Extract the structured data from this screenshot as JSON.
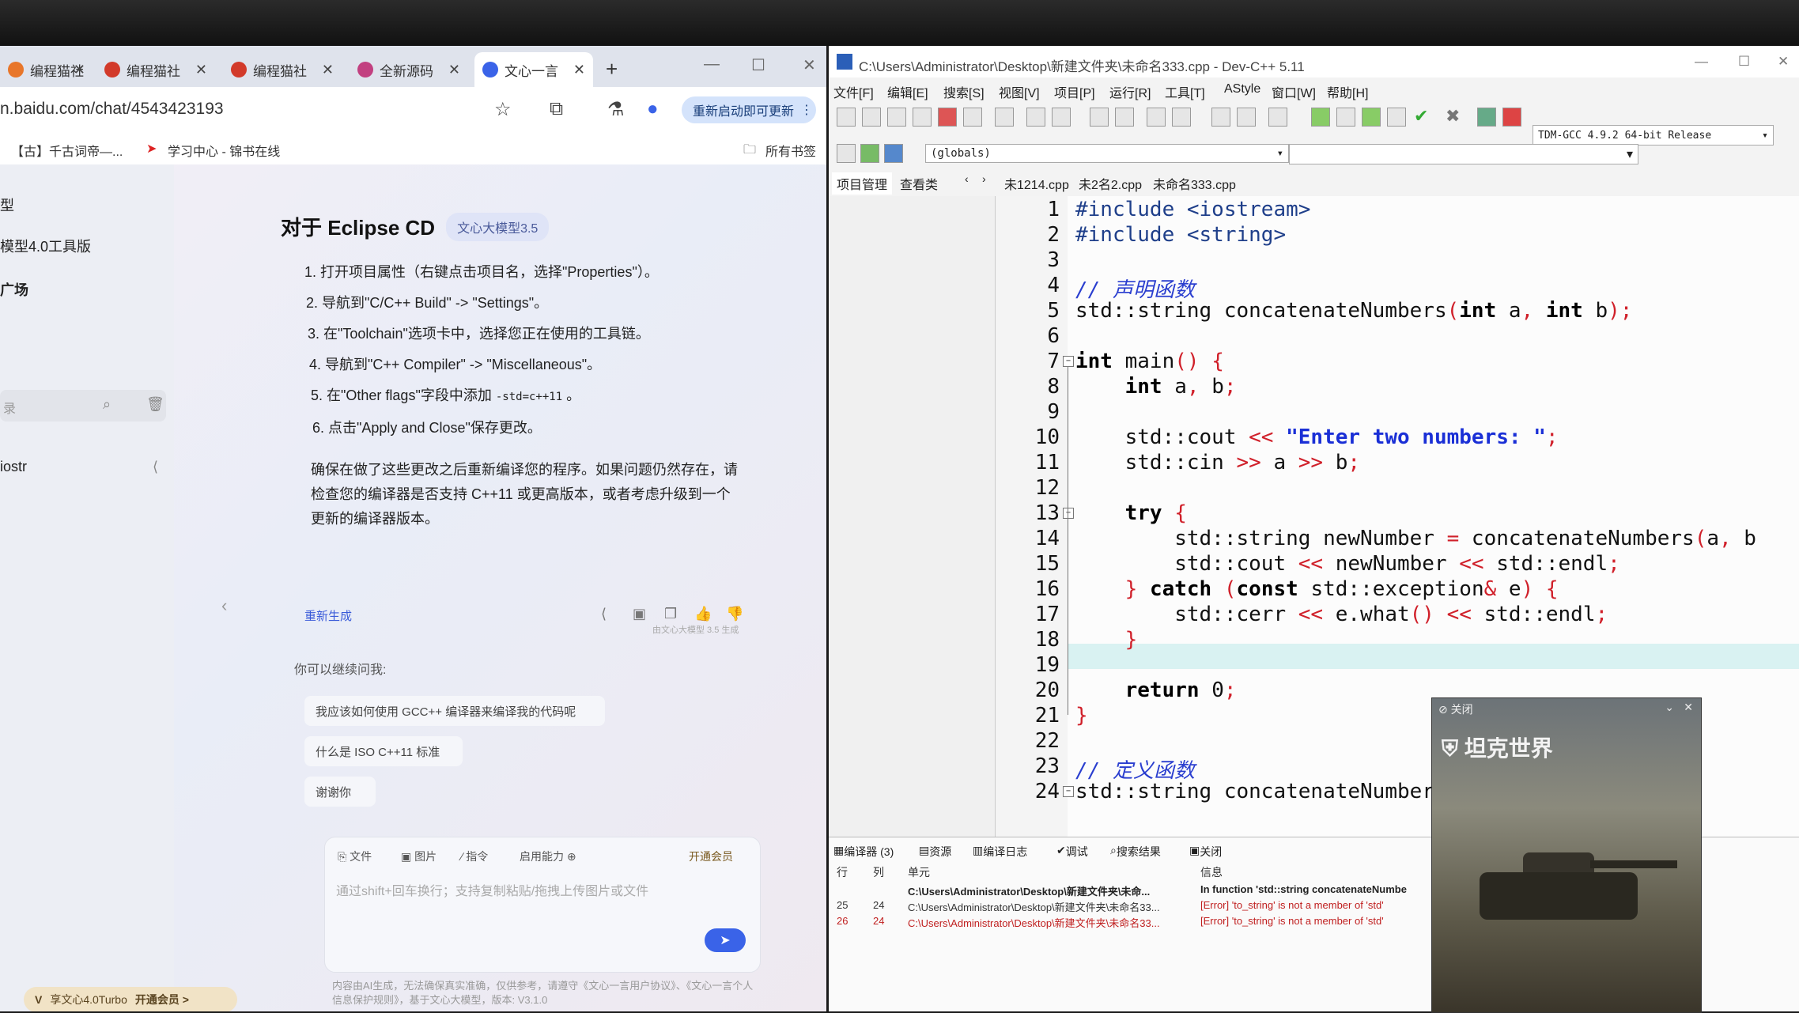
{
  "browser": {
    "tabs": [
      {
        "label": "编程猫社",
        "active": false
      },
      {
        "label": "编程猫社",
        "active": false
      },
      {
        "label": "编程猫社",
        "active": false
      },
      {
        "label": "全新源码",
        "active": false
      },
      {
        "label": "文心一言",
        "active": true
      }
    ],
    "new_tab": "+",
    "url": "n.baidu.com/chat/4543423193",
    "restart_button": "重新启动即可更新",
    "bookmarks": [
      "【古】千古词帝—...",
      "学习中心 - 锦书在线"
    ],
    "all_bookmarks": "所有书签"
  },
  "sidebar": {
    "items": [
      "型",
      "模型4.0工具版",
      "广场",
      "iostr"
    ],
    "search_placeholder": "录"
  },
  "answer": {
    "title": "对于 Eclipse CD",
    "model_tag": "文心大模型3.5",
    "steps": [
      "1. 打开项目属性（右键点击项目名，选择\"Properties\"）。",
      "2. 导航到\"C/C++ Build\" -> \"Settings\"。",
      "3. 在\"Toolchain\"选项卡中，选择您正在使用的工具链。",
      "4. 导航到\"C++ Compiler\" -> \"Miscellaneous\"。",
      "5. 在\"Other flags\"字段中添加",
      "6. 点击\"Apply and Close\"保存更改。"
    ],
    "step5_code": "-std=c++11",
    "step5_end": "。",
    "paragraph": "确保在做了这些更改之后重新编译您的程序。如果问题仍然存在，请检查您的编译器是否支持 C++11 或更高版本，或者考虑升级到一个更新的编译器版本。",
    "regenerate": "重新生成",
    "watermark": "由文心大模型 3.5 生成"
  },
  "followups": {
    "label": "你可以继续问我:",
    "items": [
      "我应该如何使用 GCC++ 编译器来编译我的代码呢",
      "什么是 ISO C++11 标准",
      "谢谢你"
    ]
  },
  "input": {
    "tools": [
      "文件",
      "图片",
      "指令",
      "启用能力"
    ],
    "member": "开通会员",
    "placeholder": "通过shift+回车换行；支持复制粘贴/拖拽上传图片或文件",
    "footer": "内容由AI生成，无法确保真实准确，仅供参考，请遵守《文心一言用户协议》、《文心一言个人信息保护规则》，基于文心大模型，版本: V3.1.0",
    "member_bar": "享文心4.0Turbo",
    "member_bar_btn": "开通会员 >"
  },
  "ide": {
    "title": "C:\\Users\\Administrator\\Desktop\\新建文件夹\\未命名333.cpp - Dev-C++ 5.11",
    "menu": [
      "文件[F]",
      "编辑[E]",
      "搜索[S]",
      "视图[V]",
      "项目[P]",
      "运行[R]",
      "工具[T]",
      "AStyle",
      "窗口[W]",
      "帮助[H]"
    ],
    "compiler": "TDM-GCC 4.9.2 64-bit Release",
    "globals": "(globals)",
    "panel_tabs": [
      "项目管理",
      "查看类"
    ],
    "file_tabs": [
      "未1214.cpp",
      "未2名2.cpp",
      "未命名333.cpp"
    ],
    "bottom_tabs": [
      "编译器 (3)",
      "资源",
      "编译日志",
      "调试",
      "搜索结果",
      "关闭"
    ],
    "bottom_cols": [
      "行",
      "列",
      "单元",
      "信息"
    ],
    "messages": [
      {
        "row": "",
        "col": "",
        "unit": "C:\\Users\\Administrator\\Desktop\\新建文件夹\\未命...",
        "info": "In function 'std::string concatenateNumbe"
      },
      {
        "row": "25",
        "col": "24",
        "unit": "C:\\Users\\Administrator\\Desktop\\新建文件夹\\未命名33...",
        "info": "[Error] 'to_string' is not a member of 'std'"
      },
      {
        "row": "26",
        "col": "24",
        "unit": "C:\\Users\\Administrator\\Desktop\\新建文件夹\\未命名33...",
        "info": "[Error] 'to_string' is not a member of 'std'"
      }
    ]
  },
  "code": {
    "line_numbers": [
      "1",
      "2",
      "3",
      "4",
      "5",
      "6",
      "7",
      "8",
      "9",
      "10",
      "11",
      "12",
      "13",
      "14",
      "15",
      "16",
      "17",
      "18",
      "19",
      "20",
      "21",
      "22",
      "23",
      "24"
    ],
    "highlighted_line": 16
  },
  "popup": {
    "close_label": "关闭",
    "logo": "坦克世界"
  },
  "colors": {
    "accent": "#3a63e8",
    "error": "#c02020",
    "highlight": "#d9f2f2"
  }
}
